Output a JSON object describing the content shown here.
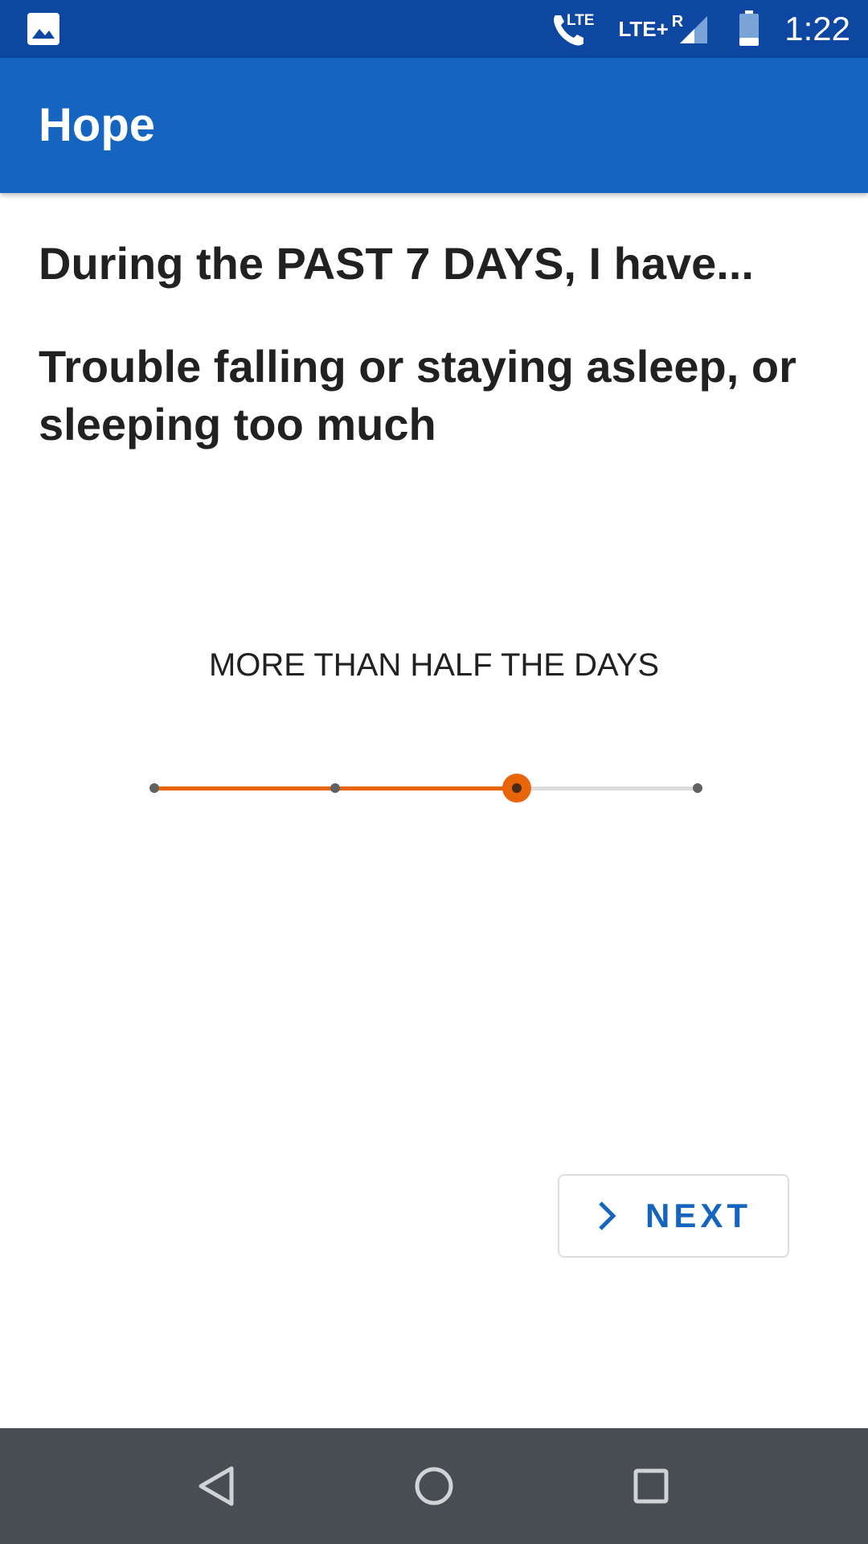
{
  "status_bar": {
    "icons": [
      "gallery-icon",
      "lte-call-icon",
      "signal-icon",
      "battery-icon"
    ],
    "call_label": "LTE",
    "network_label": "LTE+",
    "roaming_label": "R",
    "time": "1:22"
  },
  "app_bar": {
    "title": "Hope"
  },
  "survey": {
    "prompt": "During the PAST 7 DAYS, I have...",
    "question": "Trouble falling or staying asleep, or sleeping too much",
    "selected_answer": "MORE THAN HALF THE DAYS",
    "slider": {
      "steps": 4,
      "selected_index": 2
    }
  },
  "next_button": {
    "label": "NEXT",
    "icon": "chevron-right-icon"
  },
  "nav_bar": {
    "icons": [
      "back-icon",
      "home-icon",
      "recents-icon"
    ]
  },
  "colors": {
    "status_bar": "#0d47a1",
    "app_bar": "#1565c0",
    "accent": "#e8650a",
    "nav_bar": "#484d52"
  }
}
